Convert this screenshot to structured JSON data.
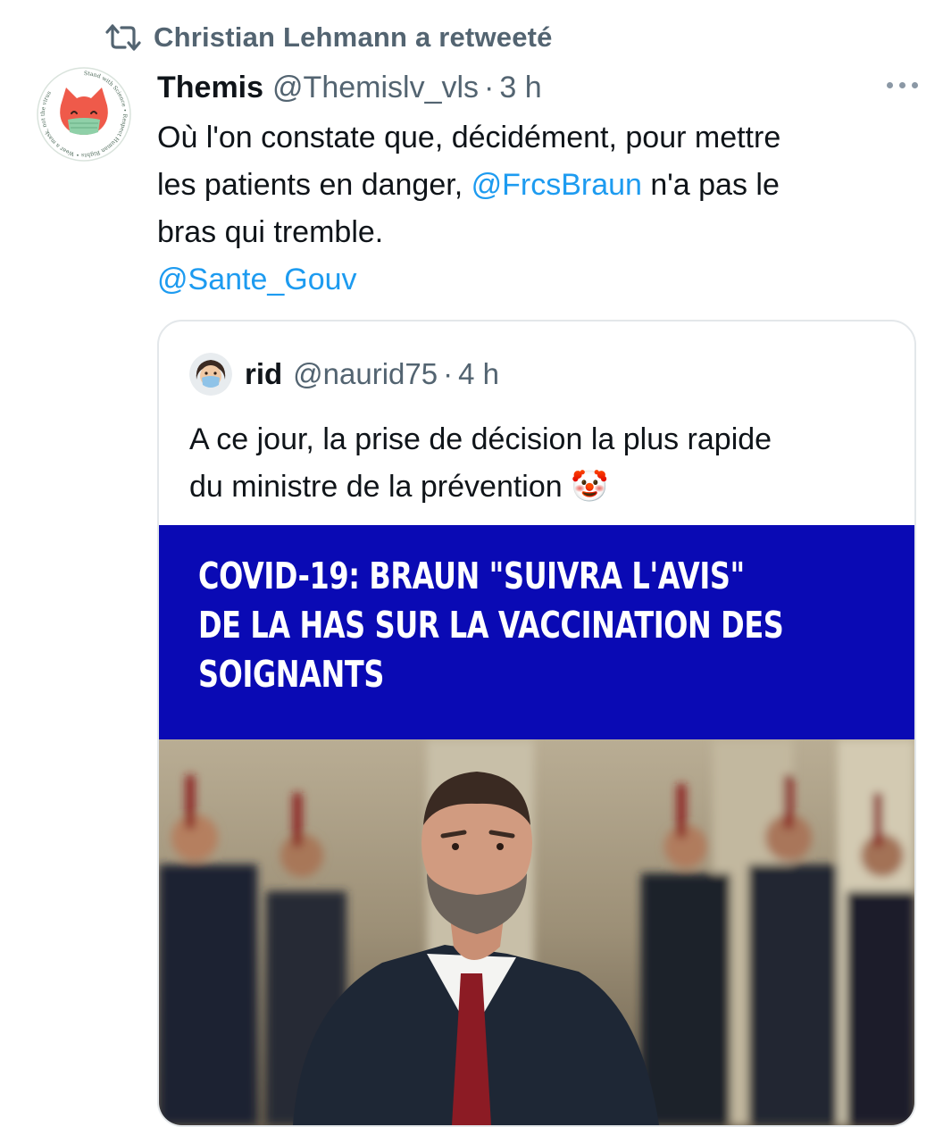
{
  "retweet": {
    "label": "Christian Lehmann a retweeté",
    "icon": "retweet-icon"
  },
  "tweet": {
    "author_name": "Themis",
    "author_handle": "@Themislv_vls",
    "time": "3 h",
    "text_lines": [
      "Où l'on constate que, décidément, pour mettre",
      "les patients en danger, ",
      " n'a pas le",
      "bras qui tremble."
    ],
    "mention_1": "@FrcsBraun",
    "mention_2": "@Sante_Gouv",
    "avatar_ring_text": "Stand with Science • Respect Human Rights • Wear a mask, not the virus"
  },
  "quote": {
    "author_name": "rid",
    "author_handle": "@naurid75",
    "time": "4 h",
    "text_line_1": "A ce jour, la prise de décision la plus rapide",
    "text_line_2": "du ministre de la prévention ",
    "emoji": "🤡",
    "headline_lines": [
      "COVID-19: BRAUN \"SUIVRA L'AVIS\"",
      "DE LA HAS SUR LA VACCINATION DES",
      "SOIGNANTS"
    ]
  },
  "colors": {
    "accent": "#1d9bf0",
    "secondary": "#536471",
    "banner": "#0a0ab4"
  }
}
